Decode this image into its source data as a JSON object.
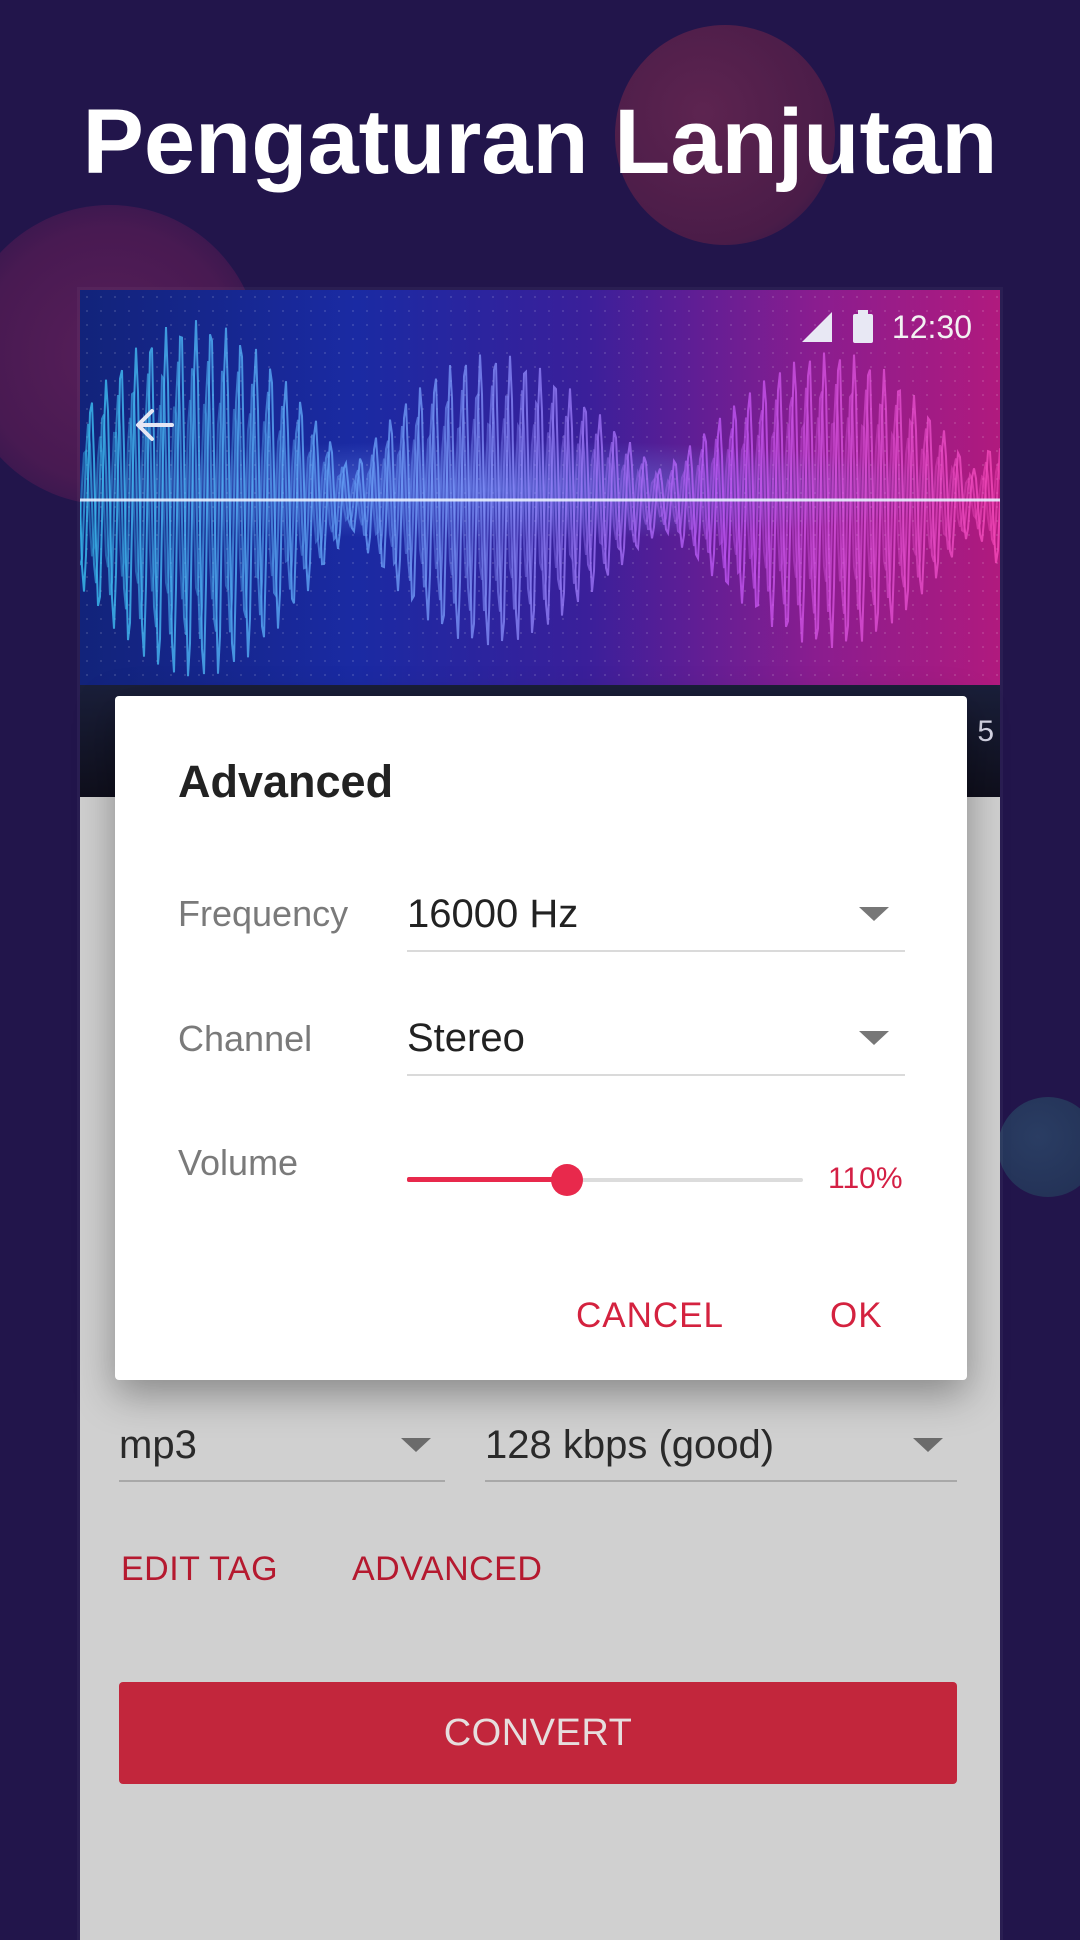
{
  "headline": "Pengaturan Lanjutan",
  "status_bar": {
    "time": "12:30",
    "icons": [
      "signal-icon",
      "battery-icon"
    ]
  },
  "header": {
    "back_icon": "back-arrow-icon",
    "hidden_edge_text": "5"
  },
  "main": {
    "format_value": "mp3",
    "bitrate_value": "128 kbps (good)",
    "edit_tag_label": "EDIT TAG",
    "advanced_label": "ADVANCED",
    "convert_label": "CONVERT"
  },
  "dialog": {
    "title": "Advanced",
    "frequency": {
      "label": "Frequency",
      "value": "16000 Hz"
    },
    "channel": {
      "label": "Channel",
      "value": "Stereo"
    },
    "volume": {
      "label": "Volume",
      "value_text": "110%",
      "slider_fraction": 0.405
    },
    "cancel_label": "CANCEL",
    "ok_label": "OK"
  },
  "colors": {
    "background": "#22154b",
    "accent": "#e8294c",
    "convert_button": "#c2263c",
    "text_button": "#d4223f"
  }
}
